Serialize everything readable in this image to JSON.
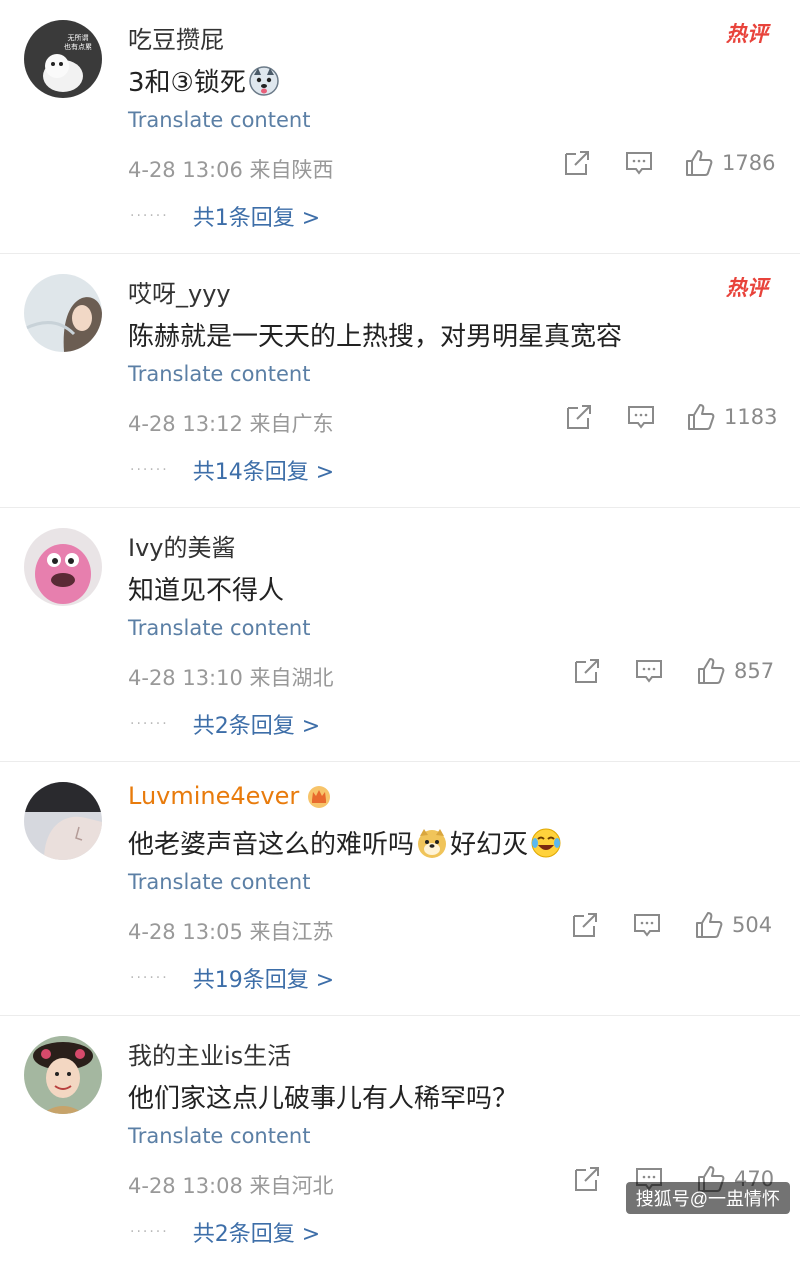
{
  "comments": [
    {
      "username": "吃豆攒屁",
      "hot_label": "热评",
      "content": "3和③锁死",
      "emoji_after": "husky-emoji",
      "translate": "Translate content",
      "meta": "4-28 13:06 来自陕西",
      "likes": "1786",
      "replies": "共1条回复 >"
    },
    {
      "username": "哎呀_yyy",
      "hot_label": "热评",
      "content": "陈赫就是一天天的上热搜，对男明星真宽容",
      "translate": "Translate content",
      "meta": "4-28 13:12 来自广东",
      "likes": "1183",
      "replies": "共14条回复 >"
    },
    {
      "username": "Ivy的美酱",
      "content": "知道见不得人",
      "translate": "Translate content",
      "meta": "4-28 13:10 来自湖北",
      "likes": "857",
      "replies": "共2条回复 >"
    },
    {
      "username": "Luvmine4ever",
      "content_part1": "他老婆声音这么的难听吗",
      "content_part2": "好幻灭",
      "translate": "Translate content",
      "meta": "4-28 13:05 来自江苏",
      "likes": "504",
      "replies": "共19条回复 >"
    },
    {
      "username": "我的主业is生活",
      "content": "他们家这点儿破事儿有人稀罕吗？",
      "translate": "Translate content",
      "meta": "4-28 13:08 来自河北",
      "likes": "470",
      "replies": "共2条回复 >"
    }
  ],
  "avatar1_text_line1": "无所谓",
  "avatar1_text_line2": "也有点累",
  "watermark": "搜狐号@一盅情怀",
  "colors": {
    "link_blue": "#3d6ea8",
    "translate_blue": "#5b7fa5",
    "vip_orange": "#e87b0c",
    "hot_red": "#e8433b"
  }
}
